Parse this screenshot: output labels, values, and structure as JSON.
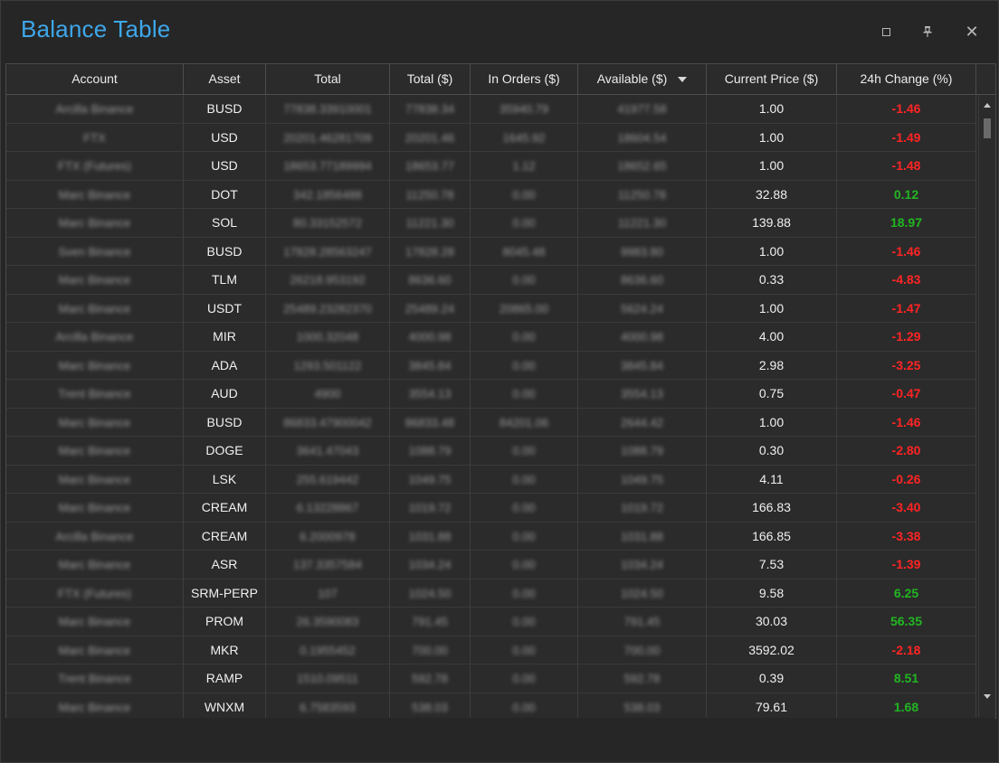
{
  "window": {
    "title": "Balance Table",
    "maximize_icon": "maximize-icon",
    "pin_icon": "pin-icon",
    "pin_glyph": "📌",
    "close_glyph": "✕"
  },
  "table": {
    "columns": [
      "Account",
      "Asset",
      "Total",
      "Total ($)",
      "In Orders ($)",
      "Available ($)",
      "Current Price ($)",
      "24h Change (%)"
    ],
    "sorted_column": "Available ($)",
    "sort_direction": "descending",
    "colors": {
      "negative": "#ff2424",
      "positive": "#22b622",
      "title": "#3ea7ea"
    },
    "rows": [
      {
        "account": "Arcilla Binance",
        "asset": "BUSD",
        "total": "77838.33910001",
        "total_usd": "77838.34",
        "in_orders": "35940.79",
        "available": "41977.58",
        "price": "1.00",
        "change": "-1.46"
      },
      {
        "account": "FTX",
        "asset": "USD",
        "total": "20201.46281709",
        "total_usd": "20201.46",
        "in_orders": "1645.92",
        "available": "18604.54",
        "price": "1.00",
        "change": "-1.49"
      },
      {
        "account": "FTX (Futures)",
        "asset": "USD",
        "total": "18653.77189994",
        "total_usd": "18653.77",
        "in_orders": "1.12",
        "available": "18652.65",
        "price": "1.00",
        "change": "-1.48"
      },
      {
        "account": "Marc Binance",
        "asset": "DOT",
        "total": "342.1856488",
        "total_usd": "11250.78",
        "in_orders": "0.00",
        "available": "11250.78",
        "price": "32.88",
        "change": "0.12"
      },
      {
        "account": "Marc Binance",
        "asset": "SOL",
        "total": "80.33152572",
        "total_usd": "11221.30",
        "in_orders": "0.00",
        "available": "11221.30",
        "price": "139.88",
        "change": "18.97"
      },
      {
        "account": "Sven Binance",
        "asset": "BUSD",
        "total": "17828.28563247",
        "total_usd": "17828.28",
        "in_orders": "8045.48",
        "available": "9983.80",
        "price": "1.00",
        "change": "-1.46"
      },
      {
        "account": "Marc Binance",
        "asset": "TLM",
        "total": "26218.953192",
        "total_usd": "8636.60",
        "in_orders": "0.00",
        "available": "8636.60",
        "price": "0.33",
        "change": "-4.83"
      },
      {
        "account": "Marc Binance",
        "asset": "USDT",
        "total": "25489.23282370",
        "total_usd": "25489.24",
        "in_orders": "20865.00",
        "available": "5624.24",
        "price": "1.00",
        "change": "-1.47"
      },
      {
        "account": "Arcilla Binance",
        "asset": "MIR",
        "total": "1000.32048",
        "total_usd": "4000.98",
        "in_orders": "0.00",
        "available": "4000.98",
        "price": "4.00",
        "change": "-1.29"
      },
      {
        "account": "Marc Binance",
        "asset": "ADA",
        "total": "1293.501122",
        "total_usd": "3845.84",
        "in_orders": "0.00",
        "available": "3845.84",
        "price": "2.98",
        "change": "-3.25"
      },
      {
        "account": "Trent Binance",
        "asset": "AUD",
        "total": "4900",
        "total_usd": "3554.13",
        "in_orders": "0.00",
        "available": "3554.13",
        "price": "0.75",
        "change": "-0.47"
      },
      {
        "account": "Marc Binance",
        "asset": "BUSD",
        "total": "86833.47900042",
        "total_usd": "86833.48",
        "in_orders": "84201.06",
        "available": "2644.42",
        "price": "1.00",
        "change": "-1.46"
      },
      {
        "account": "Marc Binance",
        "asset": "DOGE",
        "total": "3641.47043",
        "total_usd": "1088.79",
        "in_orders": "0.00",
        "available": "1088.79",
        "price": "0.30",
        "change": "-2.80"
      },
      {
        "account": "Marc Binance",
        "asset": "LSK",
        "total": "255.619442",
        "total_usd": "1049.75",
        "in_orders": "0.00",
        "available": "1049.75",
        "price": "4.11",
        "change": "-0.26"
      },
      {
        "account": "Marc Binance",
        "asset": "CREAM",
        "total": "6.13228867",
        "total_usd": "1019.72",
        "in_orders": "0.00",
        "available": "1019.72",
        "price": "166.83",
        "change": "-3.40"
      },
      {
        "account": "Arcilla Binance",
        "asset": "CREAM",
        "total": "6.2000978",
        "total_usd": "1031.88",
        "in_orders": "0.00",
        "available": "1031.88",
        "price": "166.85",
        "change": "-3.38"
      },
      {
        "account": "Marc Binance",
        "asset": "ASR",
        "total": "137.3357584",
        "total_usd": "1034.24",
        "in_orders": "0.00",
        "available": "1034.24",
        "price": "7.53",
        "change": "-1.39"
      },
      {
        "account": "FTX (Futures)",
        "asset": "SRM-PERP",
        "total": "107",
        "total_usd": "1024.50",
        "in_orders": "0.00",
        "available": "1024.50",
        "price": "9.58",
        "change": "6.25"
      },
      {
        "account": "Marc Binance",
        "asset": "PROM",
        "total": "26.3590083",
        "total_usd": "791.45",
        "in_orders": "0.00",
        "available": "791.45",
        "price": "30.03",
        "change": "56.35"
      },
      {
        "account": "Marc Binance",
        "asset": "MKR",
        "total": "0.1955452",
        "total_usd": "700.00",
        "in_orders": "0.00",
        "available": "700.00",
        "price": "3592.02",
        "change": "-2.18"
      },
      {
        "account": "Trent Binance",
        "asset": "RAMP",
        "total": "1510.09511",
        "total_usd": "592.78",
        "in_orders": "0.00",
        "available": "592.78",
        "price": "0.39",
        "change": "8.51"
      },
      {
        "account": "Marc Binance",
        "asset": "WNXM",
        "total": "6.7583593",
        "total_usd": "538.03",
        "in_orders": "0.00",
        "available": "538.03",
        "price": "79.61",
        "change": "1.68"
      }
    ]
  }
}
